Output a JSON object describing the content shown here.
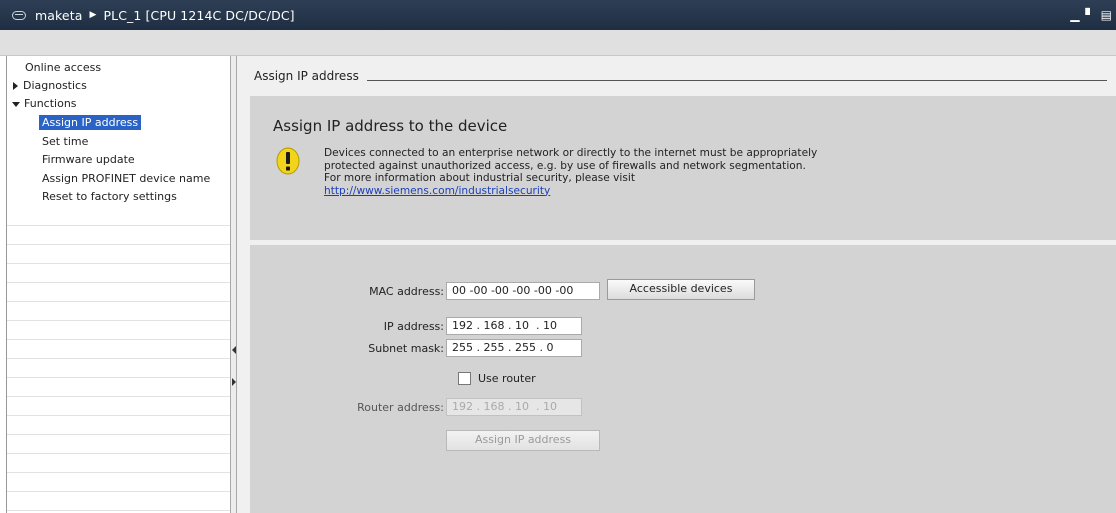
{
  "titlebar": {
    "project": "maketa",
    "device": "PLC_1 [CPU 1214C DC/DC/DC]",
    "separator": "▶"
  },
  "nav": {
    "items": [
      {
        "label": "Online access"
      },
      {
        "label": "Diagnostics"
      },
      {
        "label": "Functions"
      },
      {
        "label": "Assign IP address",
        "selected": true
      },
      {
        "label": "Set time"
      },
      {
        "label": "Firmware update"
      },
      {
        "label": "Assign PROFINET device name"
      },
      {
        "label": "Reset to factory settings"
      }
    ]
  },
  "main": {
    "section_title": "Assign IP address",
    "warning": {
      "heading": "Assign IP address to the device",
      "line1": "Devices connected to an enterprise network or directly to the internet must be appropriately",
      "line2": "protected against unauthorized access, e.g. by use of firewalls and network segmentation.",
      "line3": "For more information about industrial security, please visit",
      "link": "http://www.siemens.com/industrialsecurity"
    },
    "form": {
      "mac_label": "MAC address:",
      "mac_value": "00 -00 -00 -00 -00 -00",
      "accessible_button": "Accessible devices",
      "ip_label": "IP address:",
      "ip_value": "192 . 168 . 10  . 10",
      "subnet_label": "Subnet mask:",
      "subnet_value": "255 . 255 . 255 . 0",
      "use_router_label": "Use router",
      "use_router_checked": false,
      "router_label": "Router address:",
      "router_value": "192 . 168 . 10  . 10",
      "assign_button": "Assign IP address"
    }
  },
  "colors": {
    "titlebar": "#1f2e42",
    "selected": "#2a63c5",
    "link": "#1a3fb8",
    "panel": "#d3d3d3",
    "warning_icon": "#f2d41b"
  },
  "icons": {
    "app": "project-icon",
    "warning": "exclamation-warning-icon"
  }
}
